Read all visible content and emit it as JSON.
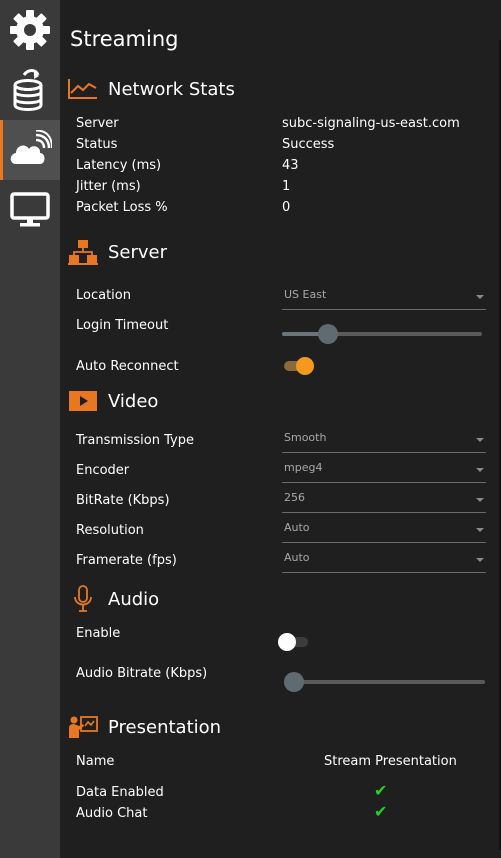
{
  "page": {
    "title": "Streaming"
  },
  "sidebar": {
    "items": [
      {
        "icon": "gear-icon",
        "active": false
      },
      {
        "icon": "database-upload-icon",
        "active": false
      },
      {
        "icon": "cloud-streaming-icon",
        "active": true
      },
      {
        "icon": "monitor-icon",
        "active": false
      }
    ],
    "accent_color": "#e87722"
  },
  "network_stats": {
    "title": "Network Stats",
    "rows": [
      {
        "label": "Server",
        "value": "subc-signaling-us-east.com"
      },
      {
        "label": "Status",
        "value": "Success"
      },
      {
        "label": "Latency (ms)",
        "value": "43"
      },
      {
        "label": "Jitter (ms)",
        "value": "1"
      },
      {
        "label": "Packet Loss %",
        "value": "0"
      }
    ]
  },
  "server": {
    "title": "Server",
    "location_label": "Location",
    "location_value": "US East",
    "login_timeout_label": "Login Timeout",
    "login_timeout_fraction": 0.2,
    "auto_reconnect_label": "Auto Reconnect",
    "auto_reconnect_on": true
  },
  "video": {
    "title": "Video",
    "rows": [
      {
        "label": "Transmission Type",
        "value": "Smooth"
      },
      {
        "label": "Encoder",
        "value": "mpeg4"
      },
      {
        "label": "BitRate (Kbps)",
        "value": "256"
      },
      {
        "label": "Resolution",
        "value": "Auto"
      },
      {
        "label": "Framerate (fps)",
        "value": "Auto"
      }
    ]
  },
  "audio": {
    "title": "Audio",
    "enable_label": "Enable",
    "enable_on": false,
    "bitrate_label": "Audio Bitrate (Kbps)",
    "bitrate_fraction": 0.0
  },
  "presentation": {
    "title": "Presentation",
    "header_name": "Name",
    "header_value": "Stream Presentation",
    "rows": [
      {
        "label": "Data Enabled",
        "checked": true
      },
      {
        "label": "Audio Chat",
        "checked": true
      }
    ]
  },
  "colors": {
    "accent": "#e87722",
    "check": "#22d12a",
    "toggle_on": "#f39a1d"
  }
}
